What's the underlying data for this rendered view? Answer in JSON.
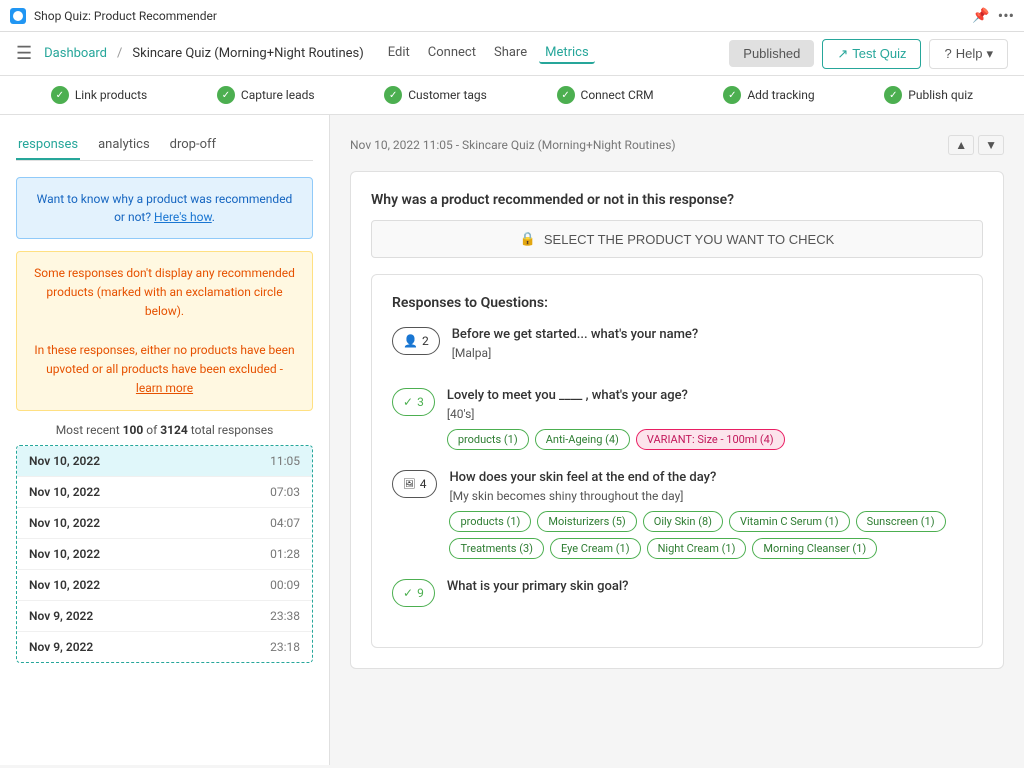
{
  "titleBar": {
    "appName": "Shop Quiz: Product Recommender",
    "pinIcon": "📌",
    "dotsIcon": "•••"
  },
  "navBar": {
    "dashboardLabel": "Dashboard",
    "separator": "/",
    "quizName": "Skincare Quiz (Morning+Night Routines)",
    "editLabel": "Edit",
    "connectLabel": "Connect",
    "shareLabel": "Share",
    "metricsLabel": "Metrics",
    "publishedLabel": "Published",
    "testQuizLabel": "Test Quiz",
    "helpLabel": "Help"
  },
  "checklist": {
    "items": [
      {
        "id": "link-products",
        "label": "Link products",
        "checked": true
      },
      {
        "id": "capture-leads",
        "label": "Capture leads",
        "checked": true
      },
      {
        "id": "customer-tags",
        "label": "Customer tags",
        "checked": true
      },
      {
        "id": "connect-crm",
        "label": "Connect CRM",
        "checked": true
      },
      {
        "id": "add-tracking",
        "label": "Add tracking",
        "checked": true
      },
      {
        "id": "publish-quiz",
        "label": "Publish quiz",
        "checked": true
      }
    ]
  },
  "tabs": [
    {
      "id": "responses",
      "label": "responses",
      "active": true
    },
    {
      "id": "analytics",
      "label": "analytics",
      "active": false
    },
    {
      "id": "dropoff",
      "label": "drop-off",
      "active": false
    }
  ],
  "infoBox": {
    "text": "Want to know why a product was recommended or not?",
    "linkText": "Here's how",
    "linkDot": "."
  },
  "warningBox": {
    "line1": "Some responses don't display any recommended products (marked with an exclamation circle below).",
    "line2": "In these responses, either no products have been upvoted or all products have been excluded -",
    "linkText": "learn more"
  },
  "mostRecent": {
    "label": "Most recent",
    "count": "100",
    "of": "of",
    "total": "3124",
    "totalLabel": "total responses"
  },
  "responseList": [
    {
      "date": "Nov 10, 2022",
      "time": "11:05",
      "selected": true
    },
    {
      "date": "Nov 10, 2022",
      "time": "07:03",
      "selected": false
    },
    {
      "date": "Nov 10, 2022",
      "time": "04:07",
      "selected": false
    },
    {
      "date": "Nov 10, 2022",
      "time": "01:28",
      "selected": false
    },
    {
      "date": "Nov 10, 2022",
      "time": "00:09",
      "selected": false
    },
    {
      "date": "Nov 9, 2022",
      "time": "23:38",
      "selected": false
    },
    {
      "date": "Nov 9, 2022",
      "time": "23:18",
      "selected": false
    }
  ],
  "rightPanel": {
    "responseHeader": "Nov 10, 2022  11:05 - Skincare Quiz (Morning+Night Routines)",
    "questionSectionTitle": "Why was a product recommended or not in this response?",
    "selectProductBtn": "SELECT THE PRODUCT YOU WANT TO CHECK",
    "responsesTitle": "Responses to Questions:",
    "questions": [
      {
        "id": 1,
        "badgeType": "person",
        "badgeNum": "2",
        "questionText": "Before we get started... what's your name?",
        "answer": "[Malpa]",
        "tags": []
      },
      {
        "id": 2,
        "badgeType": "check",
        "badgeNum": "3",
        "questionText": "Lovely to meet you ____ , what's your age?",
        "answer": "[40's]",
        "tags": [
          {
            "label": "products (1)",
            "type": "green"
          },
          {
            "label": "Anti-Ageing (4)",
            "type": "green"
          },
          {
            "label": "VARIANT: Size - 100ml (4)",
            "type": "pink"
          }
        ]
      },
      {
        "id": 3,
        "badgeType": "img",
        "badgeNum": "4",
        "questionText": "How does your skin feel at the end of the day?",
        "answer": "[My skin becomes shiny throughout the day]",
        "tags": [
          {
            "label": "products (1)",
            "type": "green"
          },
          {
            "label": "Moisturizers (5)",
            "type": "green"
          },
          {
            "label": "Oily Skin (8)",
            "type": "green"
          },
          {
            "label": "Vitamin C Serum (1)",
            "type": "green"
          },
          {
            "label": "Sunscreen (1)",
            "type": "green"
          },
          {
            "label": "Treatments (3)",
            "type": "green"
          },
          {
            "label": "Eye Cream (1)",
            "type": "green"
          },
          {
            "label": "Night Cream (1)",
            "type": "green"
          },
          {
            "label": "Morning Cleanser (1)",
            "type": "green"
          }
        ]
      },
      {
        "id": 4,
        "badgeType": "check",
        "badgeNum": "9",
        "questionText": "What is your primary skin goal?",
        "answer": "",
        "tags": []
      }
    ]
  },
  "colors": {
    "teal": "#26a69a",
    "green": "#4caf50",
    "orange": "#e65100",
    "pink": "#e91e63",
    "blue": "#1976d2"
  }
}
